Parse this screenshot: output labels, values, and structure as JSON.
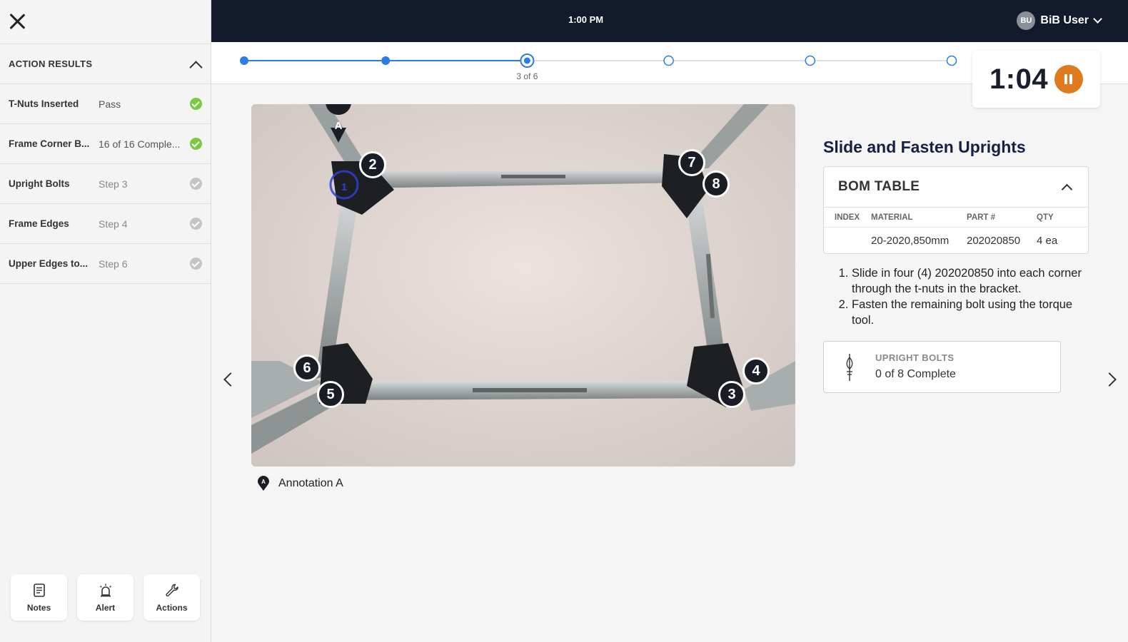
{
  "header": {
    "time": "1:00 PM",
    "user_initials": "BU",
    "user_name": "BiB User"
  },
  "sidebar": {
    "title": "ACTION RESULTS",
    "items": [
      {
        "name": "T-Nuts Inserted",
        "value": "Pass",
        "status": "complete"
      },
      {
        "name": "Frame Corner B...",
        "value": "16 of 16 Comple...",
        "status": "complete"
      },
      {
        "name": "Upright Bolts",
        "value": "Step 3",
        "status": "pending"
      },
      {
        "name": "Frame Edges",
        "value": "Step 4",
        "status": "pending"
      },
      {
        "name": "Upper Edges to...",
        "value": "Step 6",
        "status": "pending"
      }
    ],
    "tools": [
      {
        "label": "Notes",
        "icon": "notes-icon"
      },
      {
        "label": "Alert",
        "icon": "alert-siren-icon"
      },
      {
        "label": "Actions",
        "icon": "wrench-icon"
      }
    ]
  },
  "progress": {
    "current_step": 3,
    "total_steps": 6,
    "label": "3 of 6"
  },
  "timer": {
    "value": "1:04",
    "state": "running"
  },
  "step": {
    "title": "Slide and Fasten Uprights",
    "annotation_caption": "Annotation A",
    "photo_markers": [
      "A",
      "1",
      "2",
      "3",
      "4",
      "5",
      "6",
      "7",
      "8"
    ],
    "bom": {
      "title": "BOM TABLE",
      "columns": [
        "INDEX",
        "MATERIAL",
        "PART #",
        "QTY"
      ],
      "rows": [
        {
          "index": "",
          "material": "20-2020,850mm",
          "part": "202020850",
          "qty": "4 ea"
        }
      ]
    },
    "instructions": [
      "Slide in four (4) 202020850 into each corner through the t-nuts in the bracket.",
      "Fasten the remaining bolt using the torque tool."
    ],
    "action_card": {
      "label": "UPRIGHT BOLTS",
      "value": "0 of 8 Complete"
    }
  },
  "colors": {
    "accent_blue": "#2a7de1",
    "pass_green": "#7ac943",
    "pending_grey": "#c4c4c4",
    "timer_orange": "#e07a1f",
    "topbar": "#121a2b",
    "title_navy": "#152042"
  }
}
